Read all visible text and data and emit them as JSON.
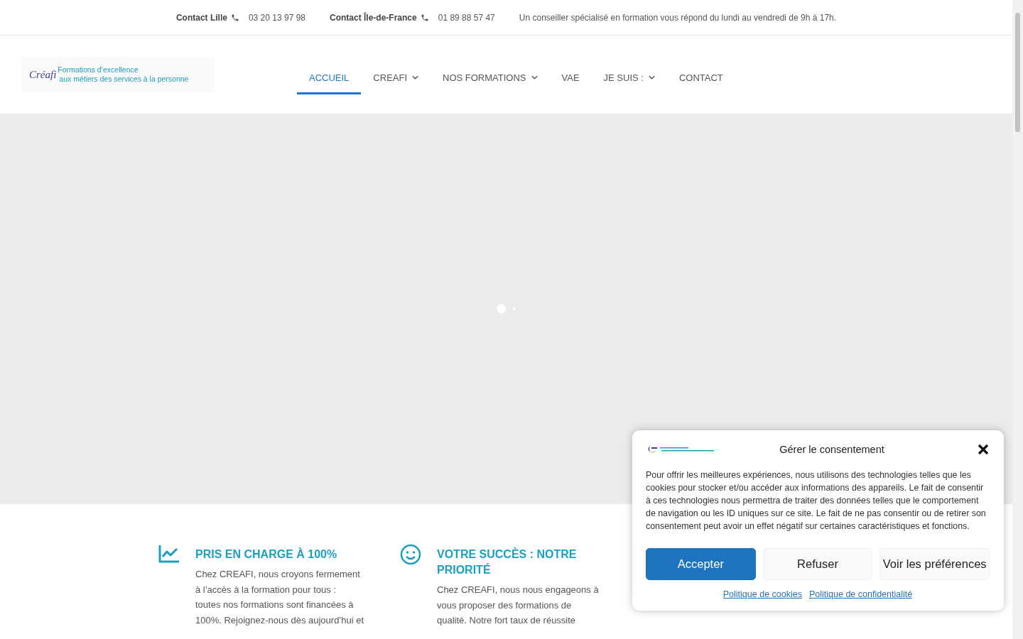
{
  "top_bar": {
    "contacts": [
      {
        "label": "Contact Lille",
        "phone": "03 20 13 97 98"
      },
      {
        "label": "Contact Île-de-France",
        "phone": "01 89 88 57 47"
      }
    ],
    "note": "Un conseiller spécialisé en formation vous répond du lundi au vendredi de 9h à 17h."
  },
  "logo": {
    "mark": "Créafi",
    "line_1": "Formations d’excellence",
    "line_2": "aux métiers des services à la personne"
  },
  "nav": [
    {
      "label": "ACCUEIL",
      "selected": true,
      "dropdown": false
    },
    {
      "label": "CREAFI",
      "selected": false,
      "dropdown": true
    },
    {
      "label": "NOS FORMATIONS",
      "selected": false,
      "dropdown": true
    },
    {
      "label": "VAE",
      "selected": false,
      "dropdown": false
    },
    {
      "label": "JE SUIS :",
      "selected": false,
      "dropdown": true
    },
    {
      "label": "CONTACT",
      "selected": false,
      "dropdown": false
    }
  ],
  "hero": {
    "kind": "loading"
  },
  "features": [
    {
      "kind": "chart",
      "title": "PRIS EN CHARGE À 100%",
      "lines": [
        "Chez CREAFI, nous croyons fermement",
        "à l’accès à la formation pour tous :",
        "toutes nos formations sont financées à",
        "100%. Rejoignez-nous dès aujourd’hui et"
      ]
    },
    {
      "kind": "smile",
      "title": "VOTRE SUCCÈS : NOTRE PRIORITÉ",
      "lines": [
        "Chez CREAFI, nous nous engageons à",
        "vous proposer des formations de",
        "qualité. Notre fort taux de réussite"
      ]
    }
  ],
  "consent": {
    "title": "Gérer le consentement",
    "text": "Pour offrir les meilleures expériences, nous utilisons des technologies telles que les cookies pour stocker et/ou accéder aux informations des appareils. Le fait de consentir à ces technologies nous permettra de traiter des données telles que le comportement de navigation ou les ID uniques sur ce site. Le fait de ne pas consentir ou de retirer son consentement peut avoir un effet négatif sur certaines caractéristiques et fonctions.",
    "buttons": [
      {
        "label": "Accepter",
        "kind": "primary"
      },
      {
        "label": "Refuser",
        "kind": "secondary"
      },
      {
        "label": "Voir les préférences",
        "kind": "secondary"
      }
    ],
    "links": [
      "Politique de cookies",
      "Politique de confidentialité"
    ]
  }
}
